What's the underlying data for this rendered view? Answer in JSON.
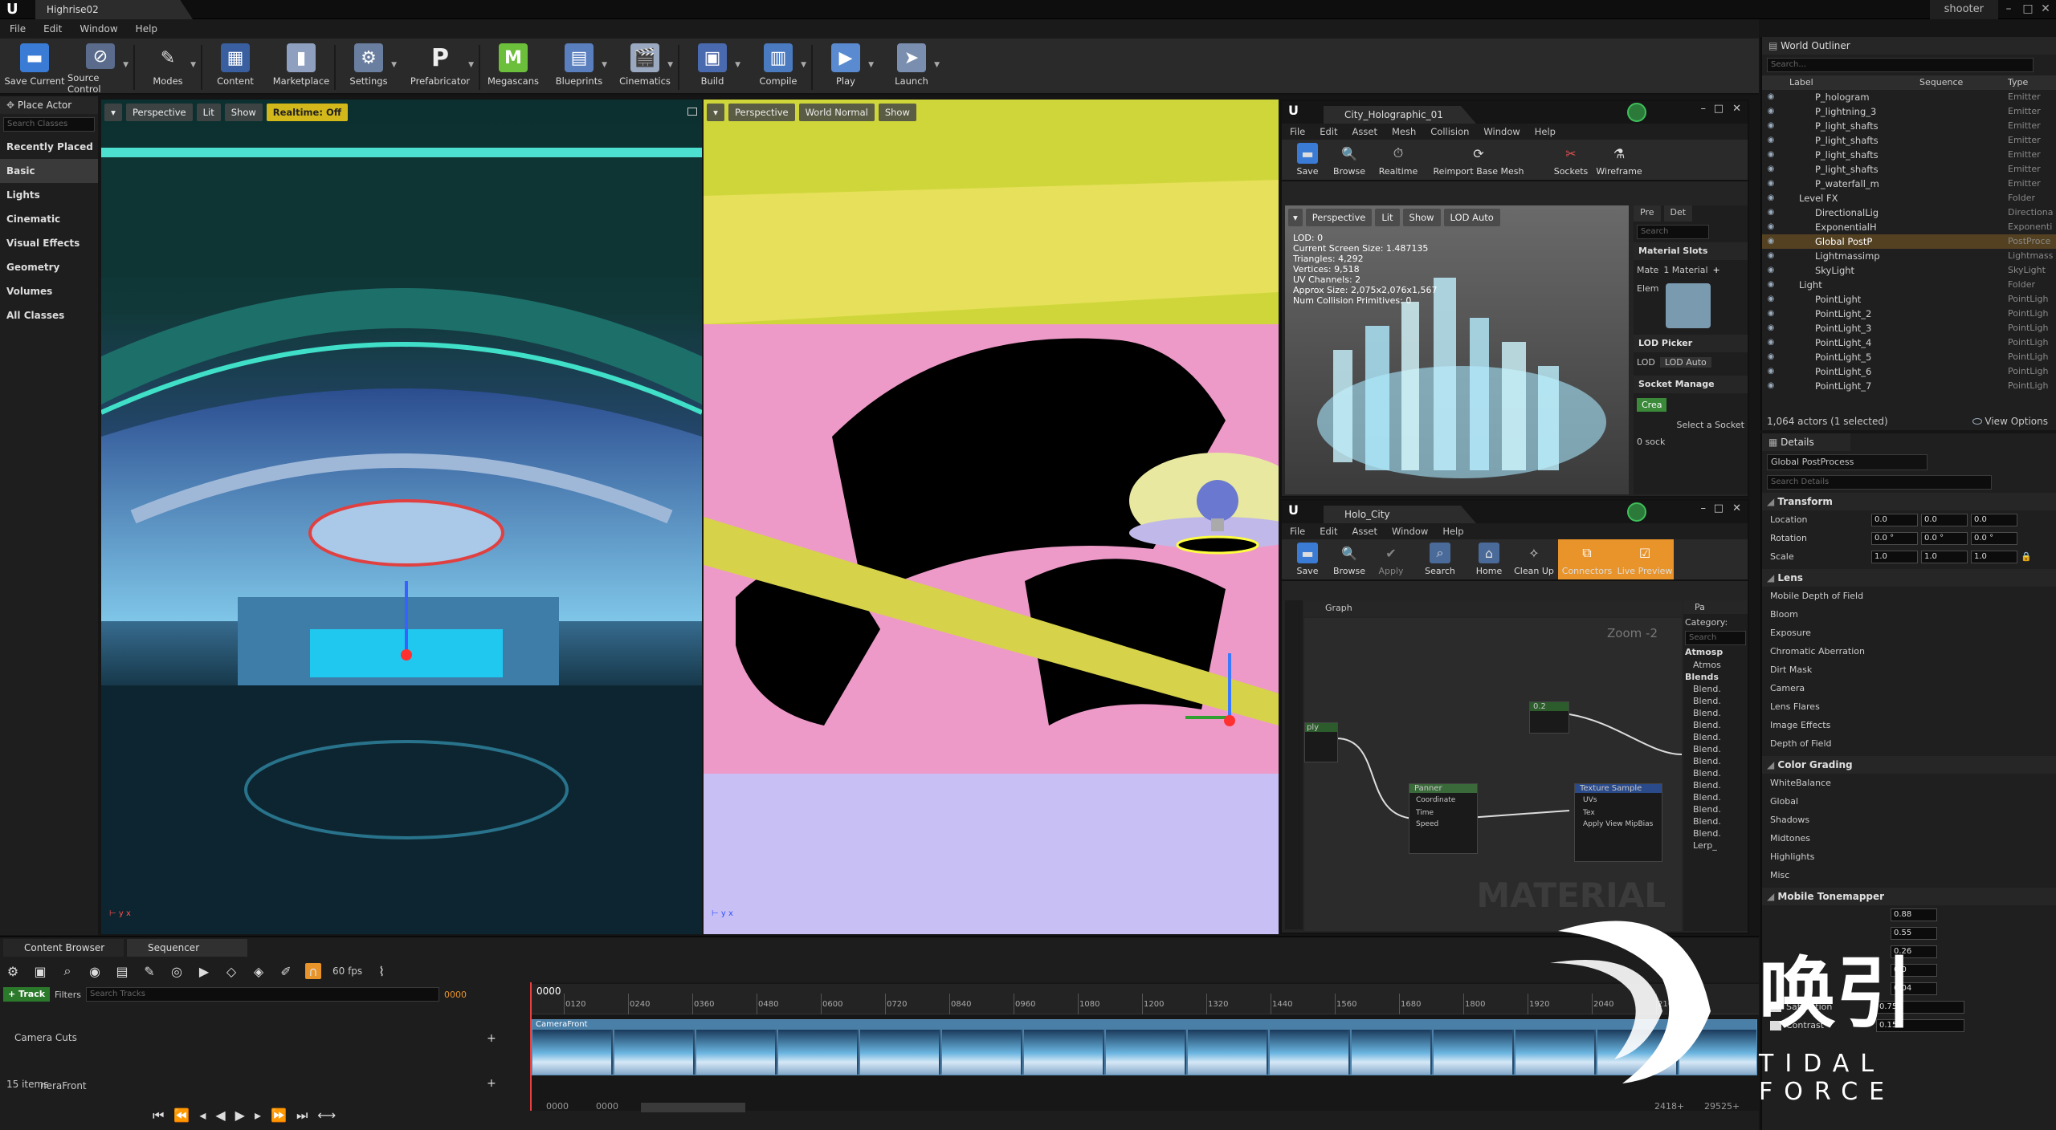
{
  "title_bar": {
    "app_logo": "U",
    "level_tab": "Highrise02",
    "project_name": "shooter"
  },
  "menu": [
    "File",
    "Edit",
    "Window",
    "Help"
  ],
  "toolbar": {
    "items": [
      {
        "label": "Save Current",
        "icon": "save-icon",
        "color": "#3a7bd5"
      },
      {
        "label": "Source Control",
        "icon": "source-control-icon",
        "color": "#5a6b8c"
      },
      {
        "label": "Modes",
        "icon": "modes-icon",
        "color": "#c8c8c8"
      },
      {
        "label": "Content",
        "icon": "content-icon",
        "color": "#3a5fa0"
      },
      {
        "label": "Marketplace",
        "icon": "marketplace-icon",
        "color": "#8f9fbf"
      },
      {
        "label": "Settings",
        "icon": "settings-icon",
        "color": "#6a7fa0"
      },
      {
        "label": "Prefabricator",
        "icon": "prefabricator-icon",
        "color": "#e0e0e0"
      },
      {
        "label": "Megascans",
        "icon": "megascans-icon",
        "color": "#6cbf3a"
      },
      {
        "label": "Blueprints",
        "icon": "blueprints-icon",
        "color": "#5a7fbf"
      },
      {
        "label": "Cinematics",
        "icon": "cinematics-icon",
        "color": "#9aa8c0"
      },
      {
        "label": "Build",
        "icon": "build-icon",
        "color": "#4a6ab0"
      },
      {
        "label": "Compile",
        "icon": "compile-icon",
        "color": "#4a7ac0"
      },
      {
        "label": "Play",
        "icon": "play-icon",
        "color": "#5a8ad0"
      },
      {
        "label": "Launch",
        "icon": "launch-icon",
        "color": "#7a8fb0"
      }
    ]
  },
  "place_actors": {
    "tab": "Place Actor",
    "search_placeholder": "Search Classes",
    "categories": [
      "Recently Placed",
      "Basic",
      "Lights",
      "Cinematic",
      "Visual Effects",
      "Geometry",
      "Volumes",
      "All Classes"
    ],
    "selected": "Basic"
  },
  "viewport_left": {
    "perspective": "Perspective",
    "lit": "Lit",
    "show": "Show",
    "realtime": "Realtime: Off"
  },
  "viewport_right": {
    "perspective": "Perspective",
    "view_mode": "World Normal",
    "show": "Show"
  },
  "static_mesh_editor": {
    "tab": "City_Holographic_01",
    "menu": [
      "File",
      "Edit",
      "Asset",
      "Mesh",
      "Collision",
      "Window",
      "Help"
    ],
    "tools": [
      "Save",
      "Browse",
      "Realtime",
      "Reimport Base Mesh",
      "Sockets",
      "Wireframe"
    ],
    "viewport_buttons": [
      "Perspective",
      "Lit",
      "Show",
      "LOD Auto"
    ],
    "stats": [
      "LOD:  0",
      "Current Screen Size: 1.487135",
      "Triangles:  4,292",
      "Vertices:  9,518",
      "UV Channels:  2",
      "Approx Size: 2,075x2,076x1,567",
      "Num Collision Primitives:  0"
    ],
    "side_tabs": [
      "Pre",
      "Det"
    ],
    "search_placeholder": "Search",
    "material_slots_header": "Material Slots",
    "material_slots_label": "Mate",
    "material_count": "1 Material",
    "element_label": "Elem",
    "lod_picker_header": "LOD Picker",
    "lod_label": "LOD",
    "lod_value": "LOD Auto",
    "socket_header": "Socket Manage",
    "create_button": "Crea",
    "select_socket": "Select a Socket",
    "socket_count": "0 sock"
  },
  "material_editor": {
    "tab": "Holo_City",
    "menu": [
      "File",
      "Edit",
      "Asset",
      "Window",
      "Help"
    ],
    "tools": [
      "Save",
      "Browse",
      "Apply",
      "Search",
      "Home",
      "Clean Up",
      "Connectors",
      "Live Preview"
    ],
    "graph_tab": "Graph",
    "palette_tab": "Pa",
    "category_label": "Category:",
    "palette_search": "Search",
    "zoom": "Zoom -2",
    "watermark": "MATERIAL",
    "palette_items": [
      "Atmosp",
      "Atmos",
      "Blends",
      "Blend.",
      "Blend.",
      "Blend.",
      "Blend.",
      "Blend.",
      "Blend.",
      "Blend.",
      "Blend.",
      "Blend.",
      "Blend.",
      "Blend.",
      "Blend.",
      "Blend.",
      "Lerp_"
    ],
    "nodes": {
      "panner": {
        "title": "Panner",
        "pins": [
          "Coordinate",
          "Time",
          "Speed"
        ]
      },
      "texture": {
        "title": "Texture Sample",
        "pins": [
          "UVs",
          "Tex",
          "Apply View MipBias"
        ]
      },
      "constant": {
        "title": "0.2"
      },
      "multiply": {
        "title": "ply"
      }
    }
  },
  "world_outliner": {
    "tab": "World Outliner",
    "search_placeholder": "Search...",
    "columns": [
      "Label",
      "Sequence",
      "Type"
    ],
    "rows": [
      {
        "label": "P_hologram",
        "type": "Emitter"
      },
      {
        "label": "P_lightning_3",
        "type": "Emitter"
      },
      {
        "label": "P_light_shafts",
        "type": "Emitter"
      },
      {
        "label": "P_light_shafts",
        "type": "Emitter"
      },
      {
        "label": "P_light_shafts",
        "type": "Emitter"
      },
      {
        "label": "P_light_shafts",
        "type": "Emitter"
      },
      {
        "label": "P_waterfall_m",
        "type": "Emitter"
      },
      {
        "label": "Level FX",
        "type": "Folder"
      },
      {
        "label": "DirectionalLig",
        "type": "Directiona"
      },
      {
        "label": "ExponentialH",
        "type": "Exponenti"
      },
      {
        "label": "Global PostP",
        "type": "PostProce"
      },
      {
        "label": "Lightmassimp",
        "type": "Lightmass"
      },
      {
        "label": "SkyLight",
        "type": "SkyLight"
      },
      {
        "label": "Light",
        "type": "Folder"
      },
      {
        "label": "PointLight",
        "type": "PointLigh"
      },
      {
        "label": "PointLight_2",
        "type": "PointLigh"
      },
      {
        "label": "PointLight_3",
        "type": "PointLigh"
      },
      {
        "label": "PointLight_4",
        "type": "PointLigh"
      },
      {
        "label": "PointLight_5",
        "type": "PointLigh"
      },
      {
        "label": "PointLight_6",
        "type": "PointLigh"
      },
      {
        "label": "PointLight_7",
        "type": "PointLigh"
      }
    ],
    "selected": "Global PostP",
    "footer_count": "1,064 actors (1 selected)",
    "view_options": "View Options"
  },
  "details": {
    "tab": "Details",
    "actor_name": "Global PostProcess",
    "search_placeholder": "Search Details",
    "transform_header": "Transform",
    "location_label": "Location",
    "rotation_label": "Rotation",
    "scale_label": "Scale",
    "location": [
      "0.0",
      "0.0",
      "0.0"
    ],
    "rotation": [
      "0.0 °",
      "0.0 °",
      "0.0 °"
    ],
    "scale": [
      "1.0",
      "1.0",
      "1.0"
    ],
    "lens_header": "Lens",
    "lens_items": [
      "Mobile Depth of Field",
      "Bloom",
      "Exposure",
      "Chromatic Aberration",
      "Dirt Mask",
      "Camera",
      "Lens Flares",
      "Image Effects",
      "Depth of Field"
    ],
    "color_grading_header": "Color Grading",
    "color_items": [
      "WhiteBalance",
      "Global",
      "Shadows",
      "Midtones",
      "Highlights",
      "Misc"
    ],
    "tonemapper_header": "Mobile Tonemapper",
    "tonemapper_values": [
      "0.88",
      "0.55",
      "0.26",
      "0.0",
      "0.04"
    ],
    "saturation_label": "Saturation",
    "saturation_value": "0.75",
    "contrast_label": "Contrast",
    "contrast_value": "0.15"
  },
  "bottom": {
    "tabs": [
      "Content Browser",
      "Sequencer"
    ],
    "fps": "60 fps",
    "track_button": "+ Track",
    "filters": "Filters",
    "search_tracks": "Search Tracks",
    "current_frame": "0000",
    "track_rows": [
      "Camera Cuts",
      "neraFront"
    ],
    "item_count": "15 items",
    "ruler_start": "0000",
    "ruler_ticks": [
      "0120",
      "0240",
      "0360",
      "0480",
      "0600",
      "0720",
      "0840",
      "0960",
      "1080",
      "1200",
      "1320",
      "1440",
      "1560",
      "1680",
      "1800",
      "1920",
      "2040",
      "2160"
    ],
    "camera_clip": "CameraFront",
    "range_start": "0000",
    "range_in": "0000",
    "range_end": "2418+",
    "range_out": "29525+"
  },
  "watermark_logo": {
    "chinese": "唤引",
    "english": "TIDAL FORCE"
  }
}
